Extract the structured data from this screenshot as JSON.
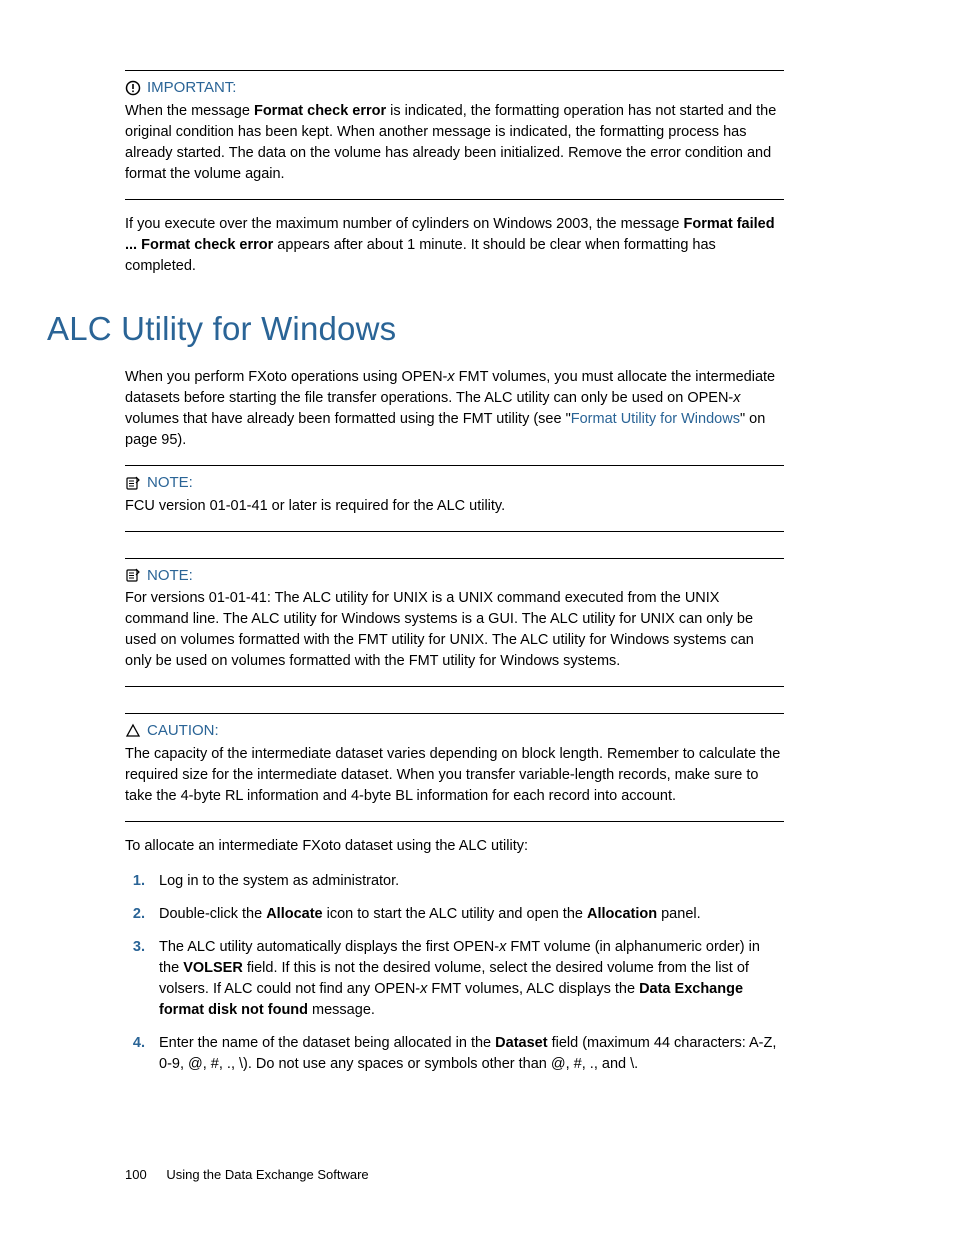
{
  "admon1": {
    "label": "IMPORTANT:",
    "p1a": "When the message ",
    "p1b": "Format check error",
    "p1c": " is indicated, the formatting operation has not started and the original condition has been kept. When another message is indicated, the formatting process has already started. The data on the volume has already been initialized. Remove the error condition and format the volume again."
  },
  "para_between": {
    "a": "If you execute over the maximum number of cylinders on Windows 2003, the message ",
    "b": "Format failed ... Format check error",
    "c": " appears after about 1 minute. It should be clear when formatting has completed."
  },
  "heading": "ALC Utility for Windows",
  "intro": {
    "a": "When you perform FXoto operations using OPEN-",
    "x1": "x",
    "b": " FMT volumes, you must allocate the intermediate datasets before starting the file transfer operations. The ALC utility can only be used on OPEN-",
    "x2": "x",
    "c": " volumes that have already been formatted using the FMT utility (see \"",
    "link": "Format Utility for Windows",
    "d": "\" on page 95)."
  },
  "note1": {
    "label": "NOTE:",
    "body": "FCU version 01-01-41 or later is required for the ALC utility."
  },
  "note2": {
    "label": "NOTE:",
    "body": "For versions 01-01-41: The ALC utility for UNIX is a UNIX command executed from the UNIX command line. The ALC utility for Windows systems is a GUI. The ALC utility for UNIX can only be used on volumes formatted with the FMT utility for UNIX. The ALC utility for Windows systems can only be used on volumes formatted with the FMT utility for Windows systems."
  },
  "caution": {
    "label": "CAUTION:",
    "body": "The capacity of the intermediate dataset varies depending on block length. Remember to calculate the required size for the intermediate dataset. When you transfer variable-length records, make sure to take the 4-byte RL information and 4-byte BL information for each record into account."
  },
  "preList": "To allocate an intermediate FXoto dataset using the ALC utility:",
  "steps": {
    "n1": "1.",
    "s1": "Log in to the system as administrator.",
    "n2": "2.",
    "s2a": "Double-click the ",
    "s2b": "Allocate",
    "s2c": " icon to start the ALC utility and open the ",
    "s2d": "Allocation",
    "s2e": " panel.",
    "n3": "3.",
    "s3a": "The ALC utility automatically displays the first OPEN-",
    "s3x": "x",
    "s3b": " FMT volume (in alphanumeric order) in the ",
    "s3c": "VOLSER",
    "s3d": " field. If this is not the desired volume, select the desired volume from the list of volsers. If ALC could not find any OPEN-",
    "s3x2": "x",
    "s3e": " FMT volumes, ALC displays the ",
    "s3f": "Data Exchange format disk not found",
    "s3g": " message.",
    "n4": "4.",
    "s4a": "Enter the name of the dataset being allocated in the ",
    "s4b": "Dataset",
    "s4c": " field (maximum 44 characters: A-Z, 0-9, @, #, ., \\). Do not use any spaces or symbols other than @, #, ., and \\."
  },
  "footer": {
    "page": "100",
    "title": "Using the Data Exchange Software"
  }
}
